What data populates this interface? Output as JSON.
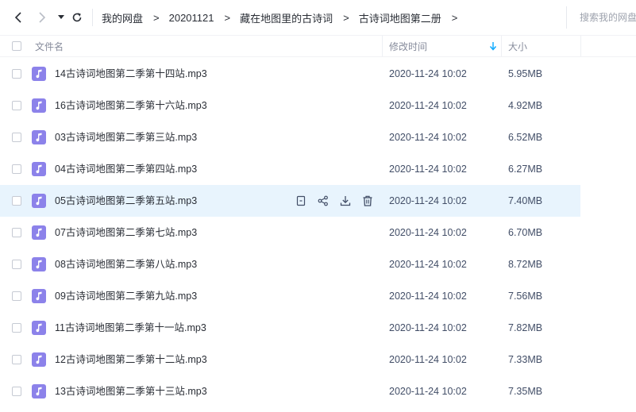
{
  "nav": {
    "back_icon": "chevron-left-icon",
    "forward_icon": "chevron-right-icon",
    "history_icon": "caret-down-icon",
    "refresh_icon": "refresh-icon"
  },
  "breadcrumb": [
    "我的网盘",
    "20201121",
    "藏在地图里的古诗词",
    "古诗词地图第二册"
  ],
  "breadcrumb_separator": ">",
  "search": {
    "placeholder": "搜索我的网盘文件"
  },
  "columns": {
    "name": "文件名",
    "mtime": "修改时间",
    "size": "大小"
  },
  "sort": {
    "column": "mtime",
    "direction": "desc",
    "icon": "sort-down-arrow-icon"
  },
  "row_actions": [
    "share-link-icon",
    "share-icon",
    "download-icon",
    "delete-icon"
  ],
  "hovered_row": 4,
  "colors": {
    "accent": "#06a7ff",
    "hover_row": "#e8f4fd",
    "audio_icon": "#8c82ea"
  },
  "files": [
    {
      "name": "14古诗词地图第二季第十四站.mp3",
      "mtime": "2020-11-24 10:02",
      "size": "5.95MB"
    },
    {
      "name": "16古诗词地图第二季第十六站.mp3",
      "mtime": "2020-11-24 10:02",
      "size": "4.92MB"
    },
    {
      "name": "03古诗词地图第二季第三站.mp3",
      "mtime": "2020-11-24 10:02",
      "size": "6.52MB"
    },
    {
      "name": "04古诗词地图第二季第四站.mp3",
      "mtime": "2020-11-24 10:02",
      "size": "6.27MB"
    },
    {
      "name": "05古诗词地图第二季第五站.mp3",
      "mtime": "2020-11-24 10:02",
      "size": "7.40MB"
    },
    {
      "name": "07古诗词地图第二季第七站.mp3",
      "mtime": "2020-11-24 10:02",
      "size": "6.70MB"
    },
    {
      "name": "08古诗词地图第二季第八站.mp3",
      "mtime": "2020-11-24 10:02",
      "size": "8.72MB"
    },
    {
      "name": "09古诗词地图第二季第九站.mp3",
      "mtime": "2020-11-24 10:02",
      "size": "7.56MB"
    },
    {
      "name": "11古诗词地图第二季第十一站.mp3",
      "mtime": "2020-11-24 10:02",
      "size": "7.82MB"
    },
    {
      "name": "12古诗词地图第二季第十二站.mp3",
      "mtime": "2020-11-24 10:02",
      "size": "7.33MB"
    },
    {
      "name": "13古诗词地图第二季第十三站.mp3",
      "mtime": "2020-11-24 10:02",
      "size": "7.35MB"
    }
  ]
}
